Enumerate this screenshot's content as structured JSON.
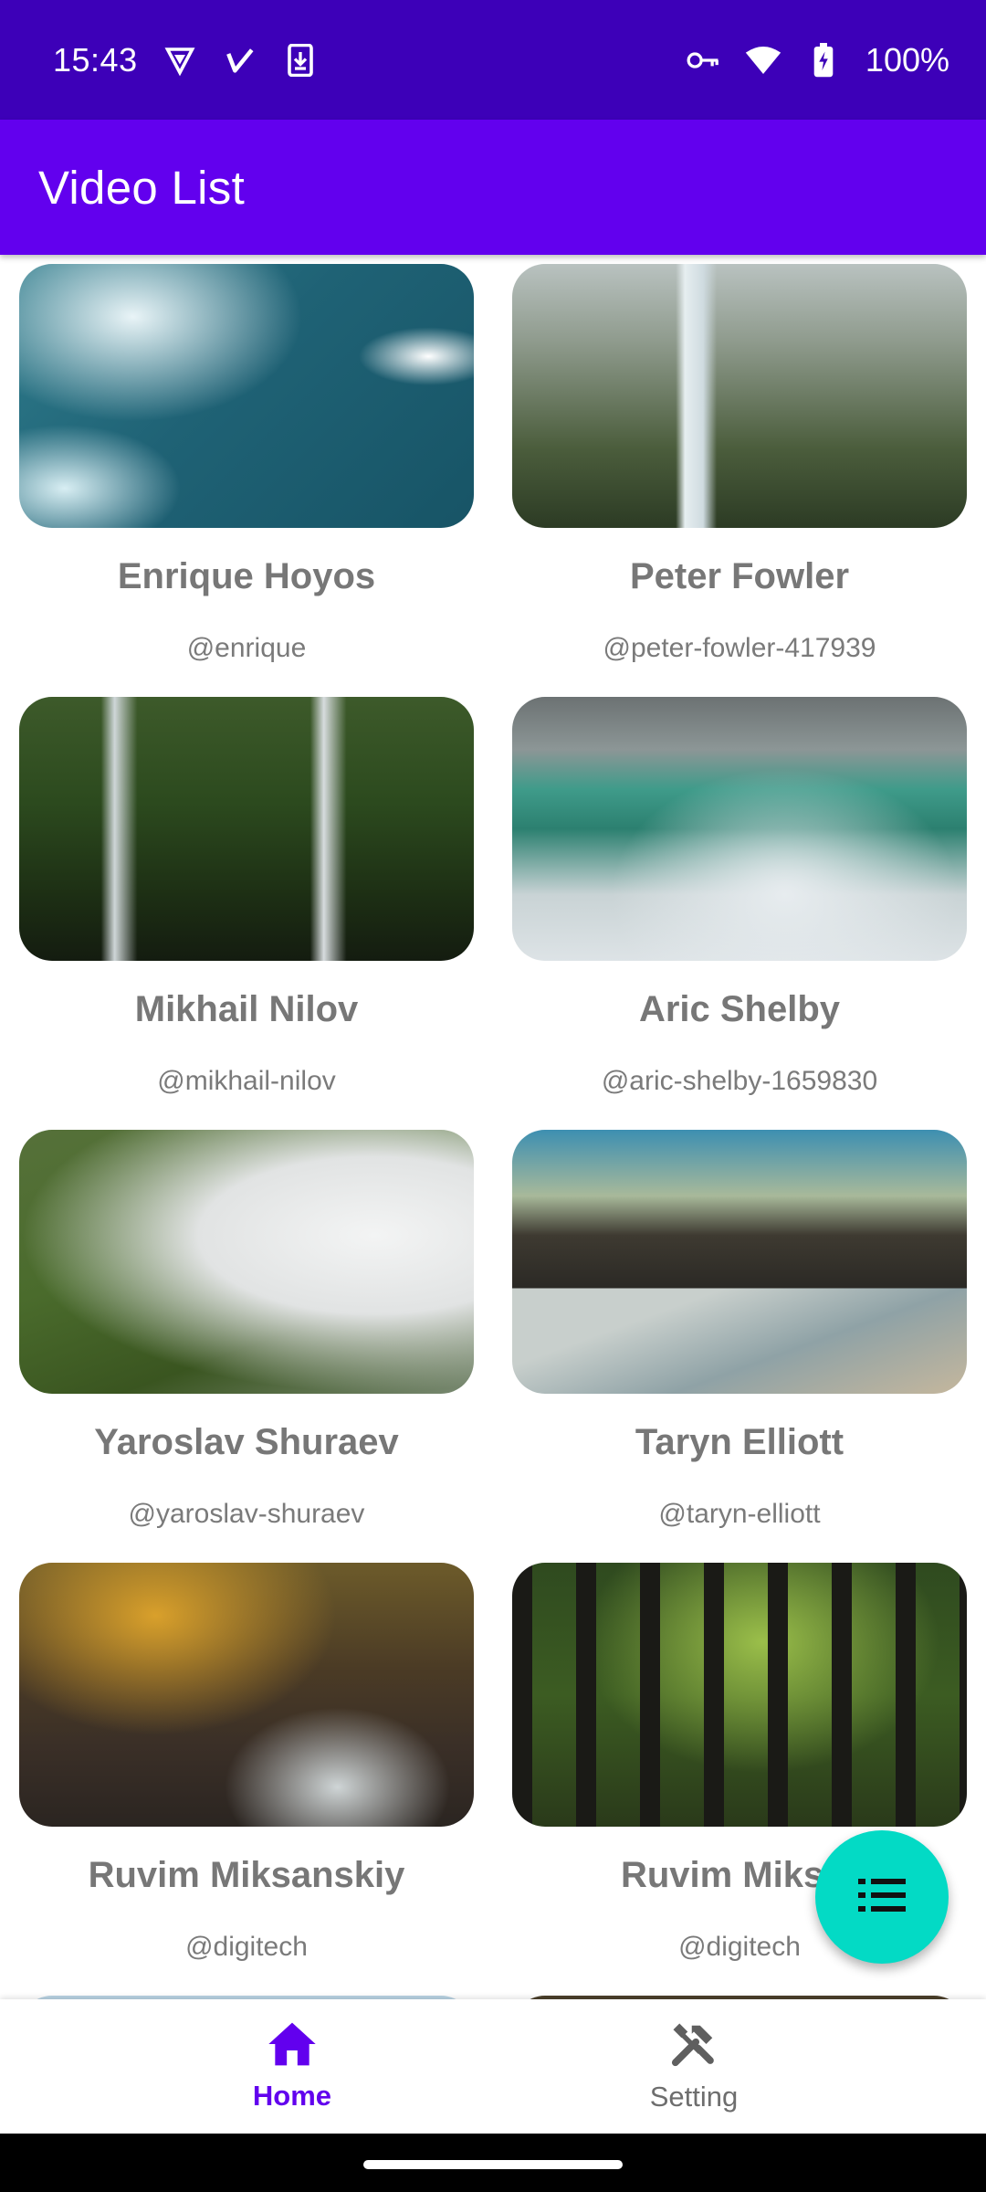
{
  "status_bar": {
    "time": "15:43",
    "battery": "100%",
    "left_icons": [
      "vpn-shield-icon",
      "check-icon",
      "download-icon"
    ],
    "right_icons": [
      "key-icon",
      "wifi-icon",
      "battery-charging-icon"
    ]
  },
  "app_bar": {
    "title": "Video List"
  },
  "videos": [
    {
      "name": "Enrique Hoyos",
      "handle": "@enrique",
      "thumb": "ocean-waves"
    },
    {
      "name": "Peter Fowler",
      "handle": "@peter-fowler-417939",
      "thumb": "forest-waterfall"
    },
    {
      "name": "Mikhail Nilov",
      "handle": "@mikhail-nilov",
      "thumb": "twin-waterfalls"
    },
    {
      "name": "Aric Shelby",
      "handle": "@aric-shelby-1659830",
      "thumb": "large-waterfall"
    },
    {
      "name": "Yaroslav Shuraev",
      "handle": "@yaroslav-shuraev",
      "thumb": "mountain-ridge-clouds"
    },
    {
      "name": "Taryn Elliott",
      "handle": "@taryn-elliott",
      "thumb": "coastline-cliffs"
    },
    {
      "name": "Ruvim Miksanskiy",
      "handle": "@digitech",
      "thumb": "autumn-creek-rocks"
    },
    {
      "name": "Ruvim Miksar",
      "handle": "@digitech",
      "thumb": "forest-trees"
    }
  ],
  "fab": {
    "icon": "list-icon"
  },
  "bottom_nav": {
    "items": [
      {
        "label": "Home",
        "icon": "home-icon",
        "active": true
      },
      {
        "label": "Setting",
        "icon": "tools-icon",
        "active": false
      }
    ]
  },
  "colors": {
    "status_bar": "#3d00b8",
    "app_bar": "#6200ee",
    "fab": "#03dac5",
    "active_nav": "#6200ee"
  }
}
